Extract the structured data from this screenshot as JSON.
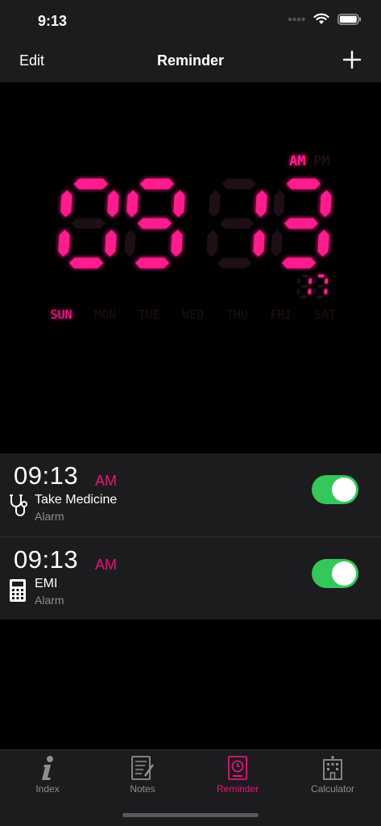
{
  "status": {
    "time": "9:13"
  },
  "nav": {
    "edit_label": "Edit",
    "title": "Reminder"
  },
  "clock": {
    "hours": "09",
    "minutes": "13",
    "seconds": "17",
    "am_label": "AM",
    "pm_label": "PM",
    "active_period": "AM",
    "days": [
      "SUN",
      "MON",
      "TUE",
      "WED",
      "THU",
      "FRI",
      "SAT"
    ],
    "active_day": "SUN",
    "color_on": "#ff1a8c",
    "color_off": "#1e0f16"
  },
  "alarms": [
    {
      "time": "09:13",
      "ampm": "AM",
      "name": "Take Medicine",
      "type": "Alarm",
      "icon": "stethoscope-icon",
      "enabled": true
    },
    {
      "time": "09:13",
      "ampm": "AM",
      "name": "EMI",
      "type": "Alarm",
      "icon": "calculator-icon",
      "enabled": true
    }
  ],
  "tabs": [
    {
      "label": "Index",
      "icon": "info-icon",
      "active": false
    },
    {
      "label": "Notes",
      "icon": "notes-icon",
      "active": false
    },
    {
      "label": "Reminder",
      "icon": "reminder-clock-icon",
      "active": true
    },
    {
      "label": "Calculator",
      "icon": "building-icon",
      "active": false
    }
  ],
  "colors": {
    "accent": "#e5127d",
    "toggle_on": "#34c759",
    "bar_bg": "#1c1c1e"
  }
}
